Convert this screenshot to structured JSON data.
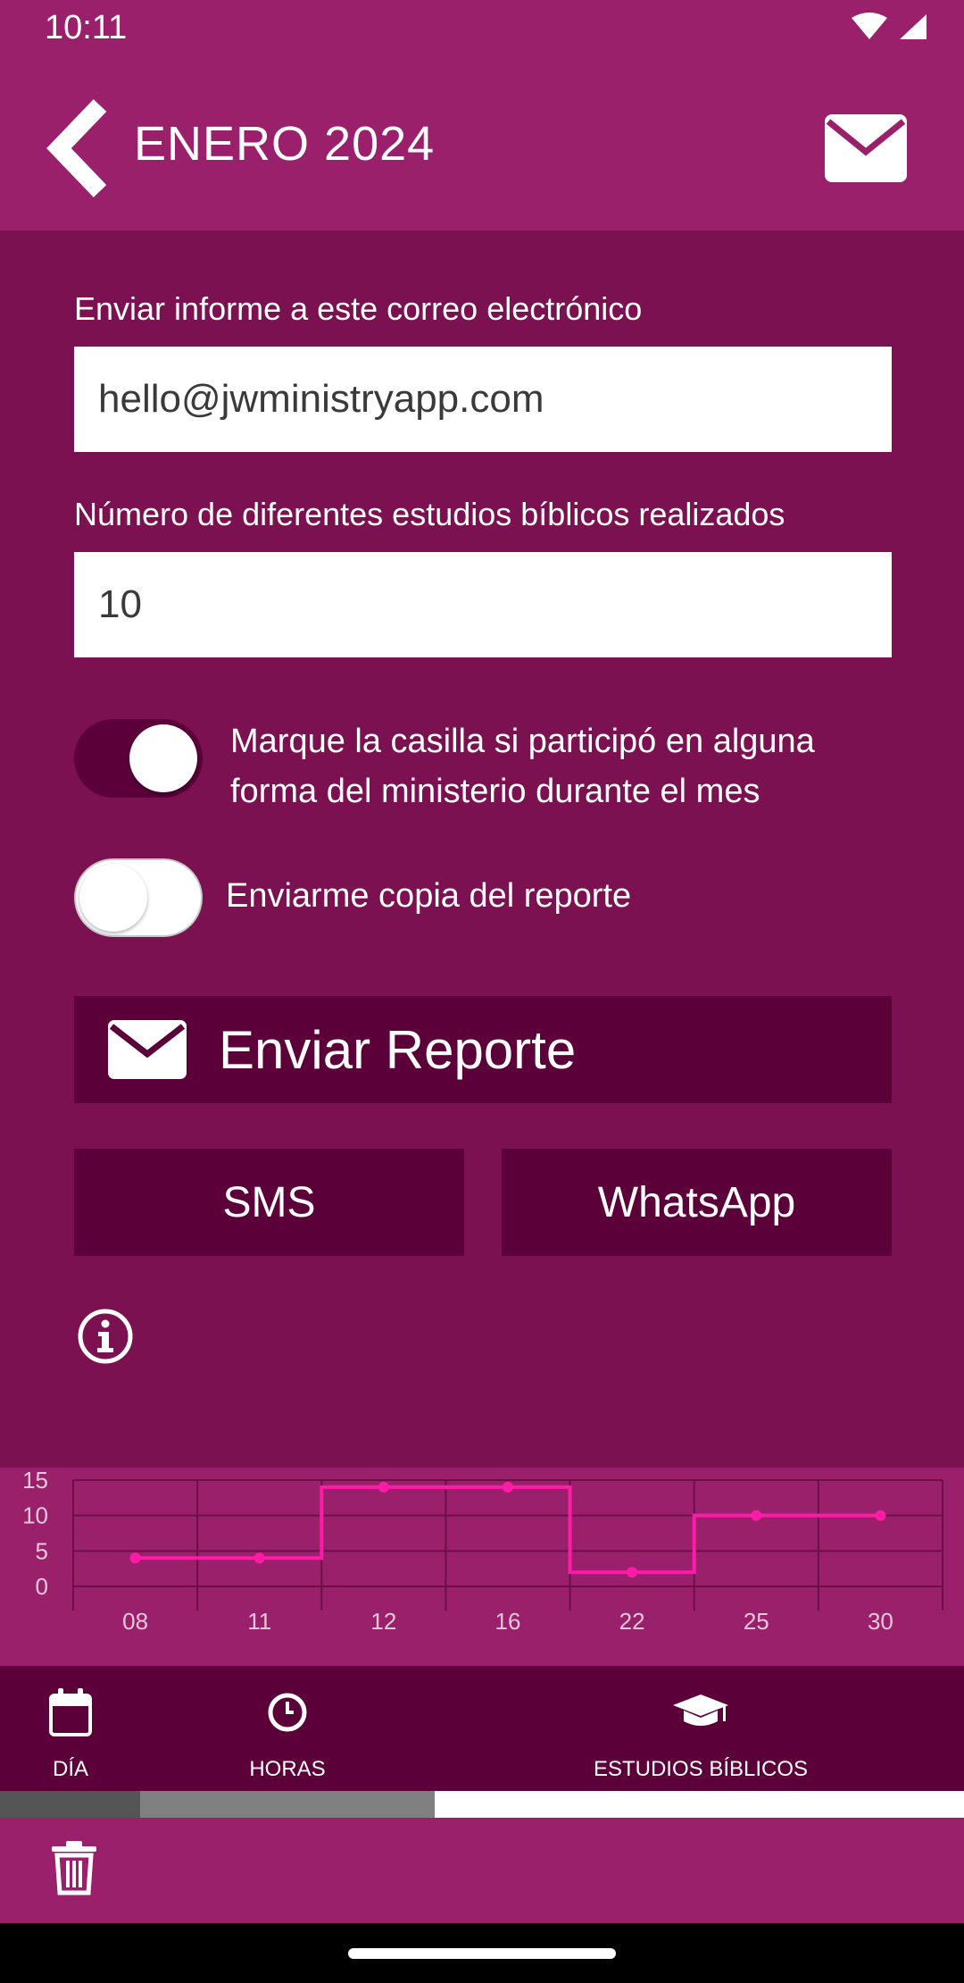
{
  "status_bar": {
    "time": "10:11",
    "icons": [
      "wifi-icon",
      "signal-icon"
    ]
  },
  "header": {
    "title": "ENERO 2024",
    "back_icon": "chevron-left-icon",
    "mail_icon": "envelope-icon"
  },
  "form": {
    "email_label": "Enviar informe a este correo electrónico",
    "email_value": "hello@jwministryapp.com",
    "studies_label": "Número de diferentes estudios bíblicos realizados",
    "studies_value": "10",
    "toggle_participated_text": "Marque la casilla si participó en alguna forma del ministerio durante el mes",
    "toggle_participated_on": true,
    "toggle_copy_text": "Enviarme copia del reporte",
    "toggle_copy_on": false
  },
  "actions": {
    "send_report_label": "Enviar Reporte",
    "sms_label": "SMS",
    "whatsapp_label": "WhatsApp",
    "info_icon": "info-circle-icon"
  },
  "chart_data": {
    "type": "line",
    "step": true,
    "x": [
      "08",
      "11",
      "12",
      "16",
      "22",
      "25",
      "30"
    ],
    "y": [
      4,
      4,
      14,
      14,
      2,
      10,
      10
    ],
    "ylim": [
      0,
      15
    ],
    "yticks": [
      15,
      10,
      5,
      0
    ],
    "color": "#ff1aa8",
    "grid": true
  },
  "bottom_nav": {
    "items": [
      {
        "label": "DÍA",
        "icon": "calendar-icon"
      },
      {
        "label": "HORAS",
        "icon": "clock-icon"
      },
      {
        "label": "ESTUDIOS BÍBLICOS",
        "icon": "graduation-cap-icon"
      }
    ]
  },
  "footer": {
    "icon": "trash-icon"
  },
  "colors": {
    "header": "#9b206c",
    "background": "#7b1150",
    "button": "#5c003a",
    "accent": "#ff1aa8"
  }
}
